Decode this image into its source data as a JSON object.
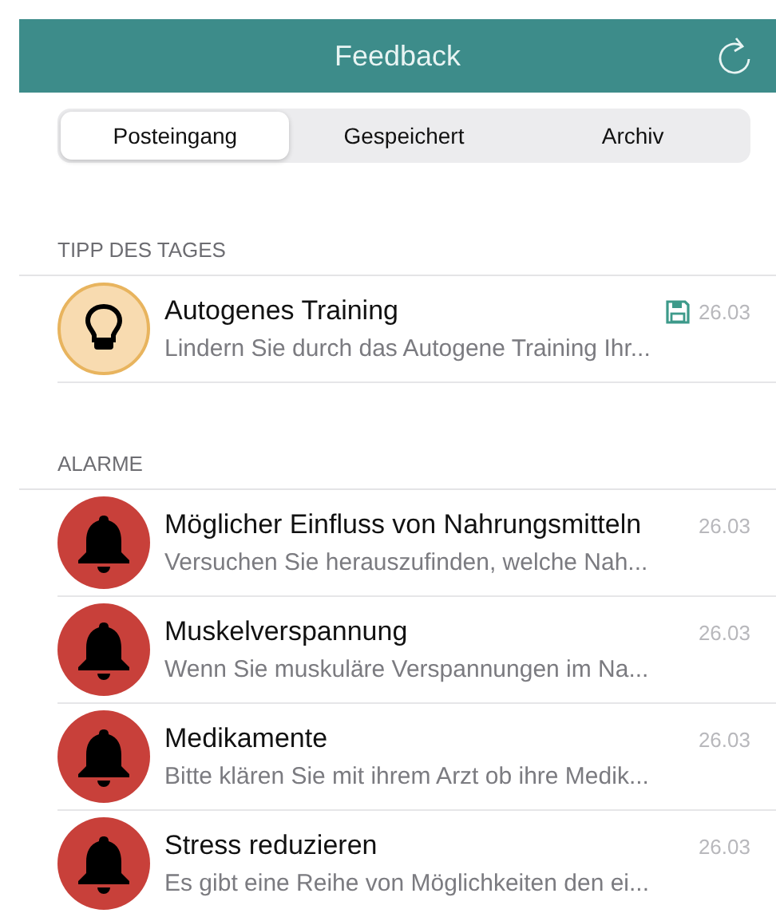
{
  "header": {
    "title": "Feedback"
  },
  "tabs": [
    {
      "label": "Posteingang",
      "selected": true
    },
    {
      "label": "Gespeichert",
      "selected": false
    },
    {
      "label": "Archiv",
      "selected": false
    }
  ],
  "sections": [
    {
      "title": "TIPP DES TAGES",
      "items": [
        {
          "kind": "tip",
          "title": "Autogenes Training",
          "preview": "Lindern Sie durch das Autogene Training Ihr...",
          "date": "26.03",
          "saved": true
        }
      ]
    },
    {
      "title": "ALARME",
      "items": [
        {
          "kind": "alarm",
          "title": "Möglicher Einfluss von Nahrungsmitteln",
          "preview": "Versuchen Sie herauszufinden, welche Nah...",
          "date": "26.03",
          "saved": false
        },
        {
          "kind": "alarm",
          "title": "Muskelverspannung",
          "preview": "Wenn Sie muskuläre Verspannungen im Na...",
          "date": "26.03",
          "saved": false
        },
        {
          "kind": "alarm",
          "title": "Medikamente",
          "preview": "Bitte klären Sie mit ihrem Arzt ob ihre Medik...",
          "date": "26.03",
          "saved": false
        },
        {
          "kind": "alarm",
          "title": "Stress reduzieren",
          "preview": "Es gibt eine Reihe von Möglichkeiten den ei...",
          "date": "26.03",
          "saved": false
        }
      ]
    }
  ]
}
